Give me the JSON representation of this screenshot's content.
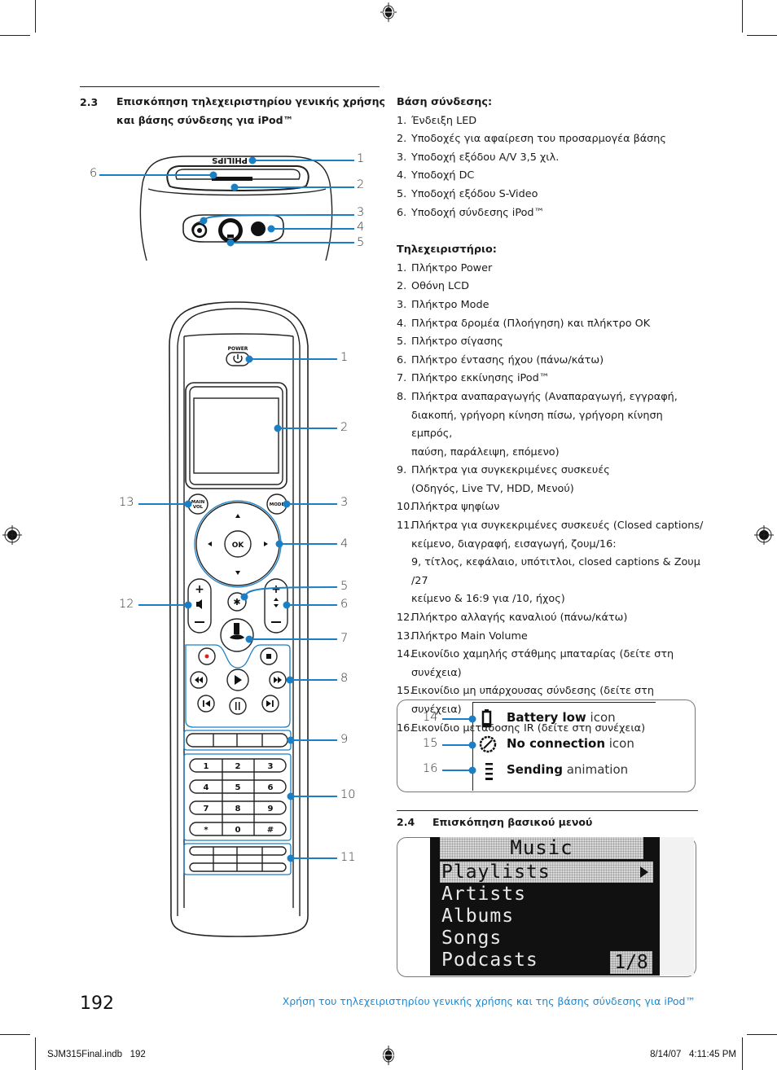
{
  "section_23": {
    "number": "2.3",
    "title_line1": "Επισκόπηση τηλεχειριστηρίου γενικής χρήσης",
    "title_line2": "και βάσης σύνδεσης για iPod™"
  },
  "dock_figure": {
    "brand": "PHILIPS",
    "callouts": [
      "1",
      "2",
      "3",
      "4",
      "5",
      "6"
    ]
  },
  "remote_figure": {
    "power_label": "POWER",
    "main_vol_label_1": "MAIN",
    "main_vol_label_2": "VOL",
    "mode_label": "MODE",
    "ok_label": "OK",
    "keypad": [
      [
        "1",
        "2",
        "3"
      ],
      [
        "4",
        "5",
        "6"
      ],
      [
        "7",
        "8",
        "9"
      ],
      [
        "*",
        "0",
        "#"
      ]
    ],
    "callouts": {
      "c1": "1",
      "c2": "2",
      "c3": "3",
      "c4": "4",
      "c5": "5",
      "c6": "6",
      "c7": "7",
      "c8": "8",
      "c9": "9",
      "c10": "10",
      "c11": "11",
      "c12": "12",
      "c13": "13"
    },
    "accent_color": "#1a7fc4"
  },
  "dock_list": {
    "heading": "Βάση σύνδεσης:",
    "items": [
      {
        "n": "1.",
        "text": "Ένδειξη LED"
      },
      {
        "n": "2.",
        "text": "Υποδοχές για αφαίρεση του προσαρμογέα βάσης"
      },
      {
        "n": "3.",
        "text": "Υποδοχή εξόδου A/V 3,5 χιλ."
      },
      {
        "n": "4.",
        "text": "Υποδοχή DC"
      },
      {
        "n": "5.",
        "text": "Υποδοχή εξόδου S-Video"
      },
      {
        "n": "6.",
        "text": "Υποδοχή σύνδεσης iPod™"
      }
    ]
  },
  "remote_list": {
    "heading": "Τηλεχειριστήριο:",
    "items": [
      {
        "n": "1.",
        "lines": [
          "Πλήκτρο Power"
        ]
      },
      {
        "n": "2.",
        "lines": [
          "Οθόνη LCD"
        ]
      },
      {
        "n": "3.",
        "lines": [
          "Πλήκτρο Mode"
        ]
      },
      {
        "n": "4.",
        "lines": [
          "Πλήκτρα δρομέα (Πλοήγηση) και πλήκτρο OK"
        ]
      },
      {
        "n": "5.",
        "lines": [
          "Πλήκτρο σίγασης"
        ]
      },
      {
        "n": "6.",
        "lines": [
          "Πλήκτρο έντασης ήχου (πάνω/κάτω)"
        ]
      },
      {
        "n": "7.",
        "lines": [
          "Πλήκτρο εκκίνησης iPod™"
        ]
      },
      {
        "n": "8.",
        "lines": [
          "Πλήκτρα αναπαραγωγής (Αναπαραγωγή, εγγραφή,",
          "διακοπή, γρήγορη κίνηση πίσω, γρήγορη κίνηση εμπρός,",
          "παύση, παράλειψη, επόμενο)"
        ]
      },
      {
        "n": "9.",
        "lines": [
          "Πλήκτρα για συγκεκριμένες συσκευές",
          "(Οδηγός, Live TV, HDD, Μενού)"
        ]
      },
      {
        "n": "10.",
        "lines": [
          "Πλήκτρα ψηφίων"
        ]
      },
      {
        "n": "11.",
        "lines": [
          "Πλήκτρα για συγκεκριμένες συσκευές (Closed captions/",
          "κείμενο, διαγραφή, εισαγωγή, ζουμ/16:",
          "9, τίτλος, κεφάλαιο, υπότιτλοι, closed captions & Ζουμ /27",
          "κείμενο & 16:9 για /10, ήχος)"
        ]
      },
      {
        "n": "12.",
        "lines": [
          "Πλήκτρο αλλαγής καναλιού (πάνω/κάτω)"
        ]
      },
      {
        "n": "13.",
        "lines": [
          "Πλήκτρο Main Volume"
        ]
      },
      {
        "n": "14.",
        "lines": [
          "Εικονίδιο χαμηλής στάθμης μπαταρίας (δείτε στη",
          "συνέχεια)"
        ]
      },
      {
        "n": "15.",
        "lines": [
          "Εικονίδιο μη υπάρχουσας σύνδεσης (δείτε στη συνέχεια)"
        ]
      },
      {
        "n": "16.",
        "lines": [
          "Εικονίδιο μετάδοσης IR (δείτε στη συνέχεια)"
        ]
      }
    ]
  },
  "icon_legend": {
    "rows": [
      {
        "num": "14",
        "bold": "Battery low",
        "rest": " icon",
        "icon": "battery-low-icon"
      },
      {
        "num": "15",
        "bold": "No connection",
        "rest": " icon",
        "icon": "no-connection-icon"
      },
      {
        "num": "16",
        "bold": "Sending",
        "rest": " animation",
        "icon": "sending-icon"
      }
    ]
  },
  "section_24": {
    "number": "2.4",
    "title": "Επισκόπηση βασικού μενού"
  },
  "lcd_menu": {
    "title": "Music",
    "items": [
      "Playlists",
      "Artists",
      "Albums",
      "Songs",
      "Podcasts"
    ],
    "selected_index": 0,
    "page_indicator": "1/8"
  },
  "footer": {
    "page_number": "192",
    "running_title": "Χρήση του τηλεχειριστηρίου γενικής χρήσης και της βάσης σύνδεσης για iPod™",
    "running_title_color": "#1a8ad4",
    "slug_file": "SJM315Final.indb   192",
    "slug_date": "8/14/07   4:11:45 PM"
  }
}
